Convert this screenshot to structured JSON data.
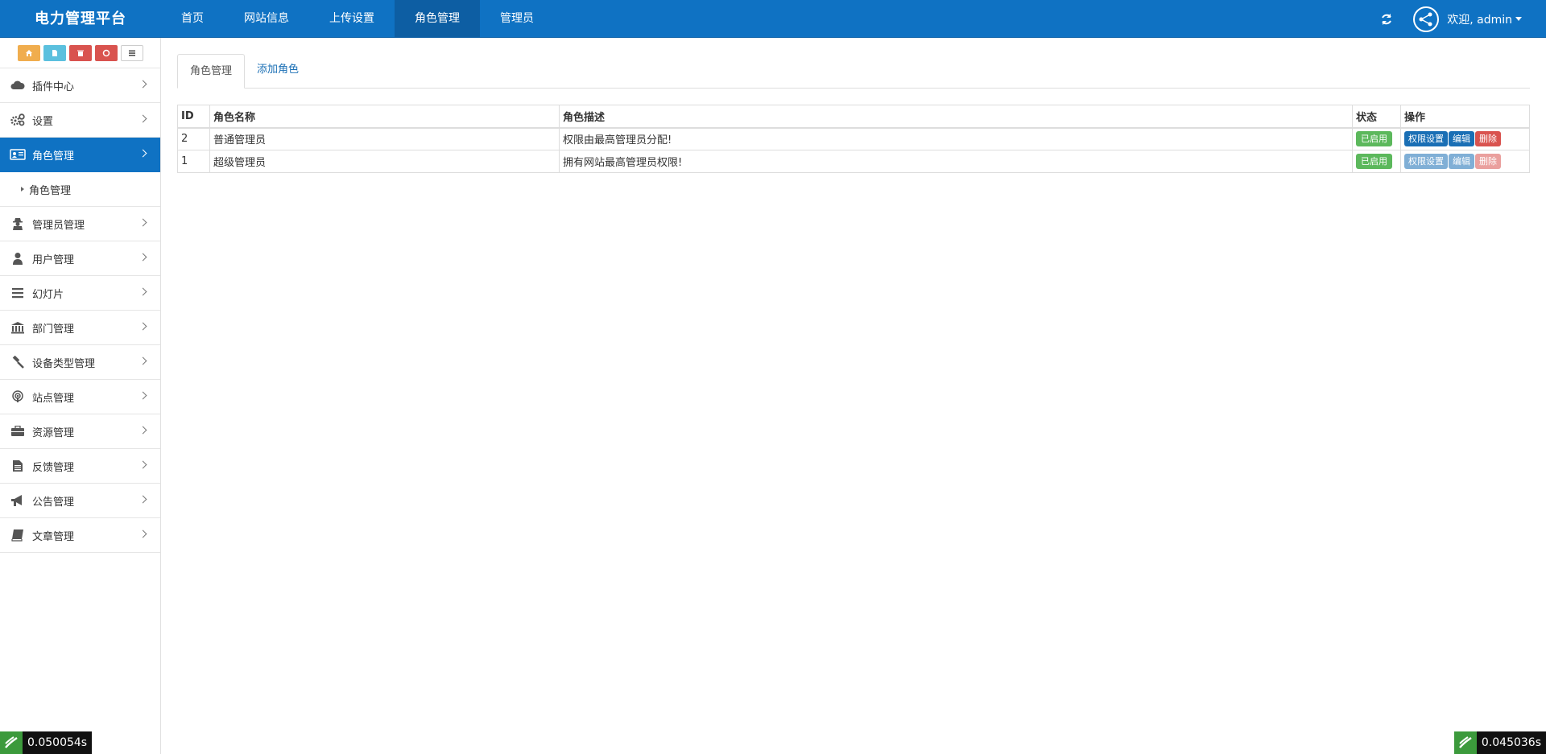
{
  "brand": "电力管理平台",
  "topnav": [
    {
      "label": "首页",
      "active": false
    },
    {
      "label": "网站信息",
      "active": false
    },
    {
      "label": "上传设置",
      "active": false
    },
    {
      "label": "角色管理",
      "active": true
    },
    {
      "label": "管理员",
      "active": false
    }
  ],
  "user": {
    "greeting": "欢迎, admin"
  },
  "sidebar": {
    "items": [
      {
        "label": "插件中心",
        "icon": "cloud-icon"
      },
      {
        "label": "设置",
        "icon": "gears-icon"
      },
      {
        "label": "角色管理",
        "icon": "id-card-icon",
        "active": true
      },
      {
        "label": "角色管理",
        "submenu": true
      },
      {
        "label": "管理员管理",
        "icon": "user-secret-icon"
      },
      {
        "label": "用户管理",
        "icon": "user-icon"
      },
      {
        "label": "幻灯片",
        "icon": "bars-icon"
      },
      {
        "label": "部门管理",
        "icon": "bank-icon"
      },
      {
        "label": "设备类型管理",
        "icon": "gavel-icon"
      },
      {
        "label": "站点管理",
        "icon": "podcast-icon"
      },
      {
        "label": "资源管理",
        "icon": "briefcase-icon"
      },
      {
        "label": "反馈管理",
        "icon": "file-text-icon"
      },
      {
        "label": "公告管理",
        "icon": "bullhorn-icon"
      },
      {
        "label": "文章管理",
        "icon": "book-icon"
      }
    ]
  },
  "tabs": [
    {
      "label": "角色管理",
      "active": true
    },
    {
      "label": "添加角色",
      "active": false
    }
  ],
  "table": {
    "headers": [
      "ID",
      "角色名称",
      "角色描述",
      "状态",
      "操作"
    ],
    "rows": [
      {
        "id": "2",
        "name": "普通管理员",
        "desc": "权限由最高管理员分配!",
        "status": "已启用",
        "actions": [
          "权限设置",
          "编辑",
          "删除"
        ],
        "disabled": false
      },
      {
        "id": "1",
        "name": "超级管理员",
        "desc": "拥有网站最高管理员权限!",
        "status": "已启用",
        "actions": [
          "权限设置",
          "编辑",
          "删除"
        ],
        "disabled": true
      }
    ]
  },
  "timers": {
    "left": "0.050054s",
    "right": "0.045036s"
  },
  "colors": {
    "primary": "#0f72c3",
    "success": "#5cb85c",
    "danger": "#d9534f",
    "warning": "#f0ad4e",
    "info": "#5bc0de"
  }
}
